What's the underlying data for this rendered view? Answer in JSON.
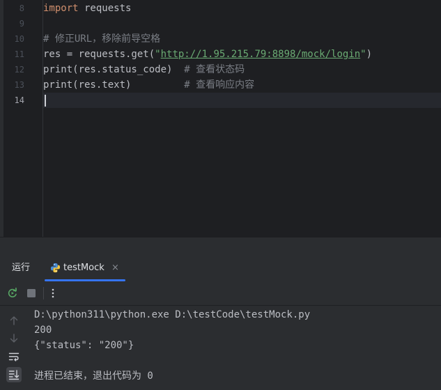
{
  "editor": {
    "line_numbers": [
      "8",
      "9",
      "10",
      "11",
      "12",
      "13",
      "14"
    ],
    "lines": {
      "l8": {
        "kw": "import",
        "rest": " requests"
      },
      "l10": {
        "comment": "# 修正URL，移除前导空格"
      },
      "l11": {
        "pre": "res = requests.get(",
        "q1": "\"",
        "url": "http://1.95.215.79:8898/mock/login",
        "q2": "\"",
        "post": ")"
      },
      "l12": {
        "code": "print(res.status_code)  ",
        "comment": "# 查看状态码"
      },
      "l13": {
        "code": "print(res.text)         ",
        "comment": "# 查看响应内容"
      }
    }
  },
  "run_panel": {
    "run_label": "运行",
    "tab": {
      "title": "testMock",
      "close": "×",
      "icon": "python-icon"
    },
    "toolbar": {
      "rerun_icon": "rerun-icon",
      "stop_icon": "stop-icon",
      "more_icon": "more-vertical-icon"
    },
    "side": [
      "arrow-up-icon",
      "arrow-down-icon",
      "soft-wrap-icon",
      "scroll-to-end-icon"
    ],
    "output": [
      "D:\\python311\\python.exe D:\\testCode\\testMock.py",
      "200",
      "{\"status\": \"200\"}",
      "",
      "进程已结束，退出代码为 0"
    ]
  },
  "colors": {
    "background": "#1e1f22",
    "panel": "#2b2d30",
    "keyword": "#cf8e6d",
    "string": "#6aab73",
    "comment": "#7a7e85",
    "accent": "#3574f0"
  }
}
